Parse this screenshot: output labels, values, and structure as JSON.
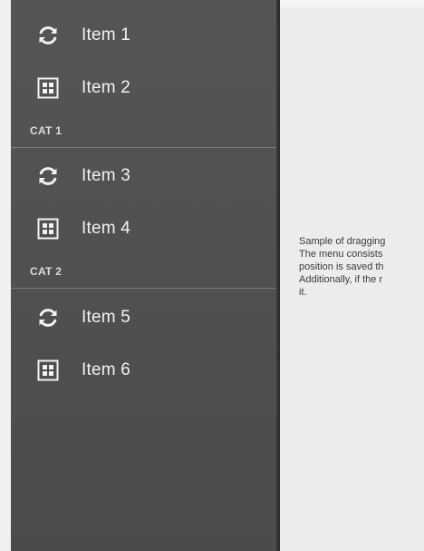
{
  "menu": {
    "items": [
      {
        "label": "Item 1",
        "icon": "refresh-icon"
      },
      {
        "label": "Item 2",
        "icon": "grid-icon"
      },
      {
        "label": "Item 3",
        "icon": "refresh-icon"
      },
      {
        "label": "Item 4",
        "icon": "grid-icon"
      },
      {
        "label": "Item 5",
        "icon": "refresh-icon"
      },
      {
        "label": "Item 6",
        "icon": "grid-icon"
      }
    ],
    "categories": [
      {
        "label": "CAT 1"
      },
      {
        "label": "CAT 2"
      }
    ]
  },
  "content": {
    "lines": [
      "Sample of dragging",
      "The menu consists",
      "position is saved th",
      "Additionally, if the r",
      "it."
    ]
  },
  "colors": {
    "drawer_background": "#515151",
    "content_background": "#ececee",
    "text_light": "#f2f2f2",
    "divider": "#7a7a7a"
  }
}
